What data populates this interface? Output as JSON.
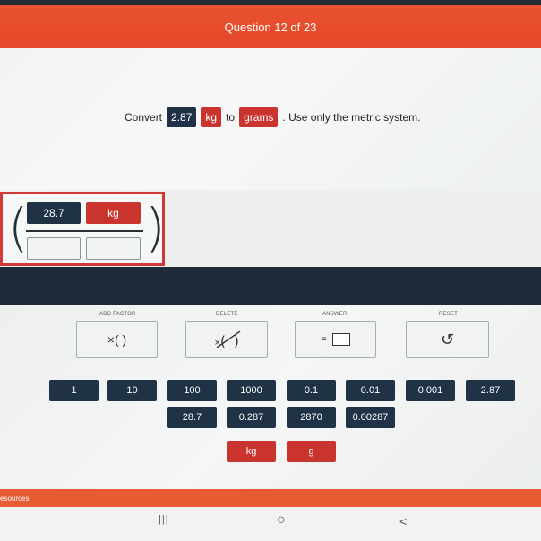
{
  "header": {
    "title": "Question 12 of 23"
  },
  "prompt": {
    "lead": "Convert",
    "value": "2.87",
    "from_unit": "kg",
    "connector": "to",
    "to_unit": "grams",
    "tail": ". Use only the metric system."
  },
  "equation": {
    "numerator_value": "28.7",
    "numerator_unit": "kg"
  },
  "tools": {
    "add_factor_label": "ADD FACTOR",
    "add_factor_symbol": "×( )",
    "delete_label": "DELETE",
    "answer_label": "ANSWER",
    "answer_symbol": "=",
    "reset_label": "RESET",
    "reset_symbol": "↺"
  },
  "values_row1": [
    "1",
    "10",
    "100",
    "1000",
    "0.1",
    "0.01",
    "0.001",
    "2.87"
  ],
  "values_row2": [
    "28.7",
    "0.287",
    "2870",
    "0.00287"
  ],
  "units": [
    "kg",
    "g"
  ],
  "footer": {
    "resources_label": "esources"
  },
  "nav": {
    "recent": "|||",
    "home": "○",
    "back": "<"
  },
  "colors": {
    "header": "#e5472a",
    "value_chip": "#1f3246",
    "unit_chip": "#c9352e",
    "band": "#1e2a38"
  }
}
